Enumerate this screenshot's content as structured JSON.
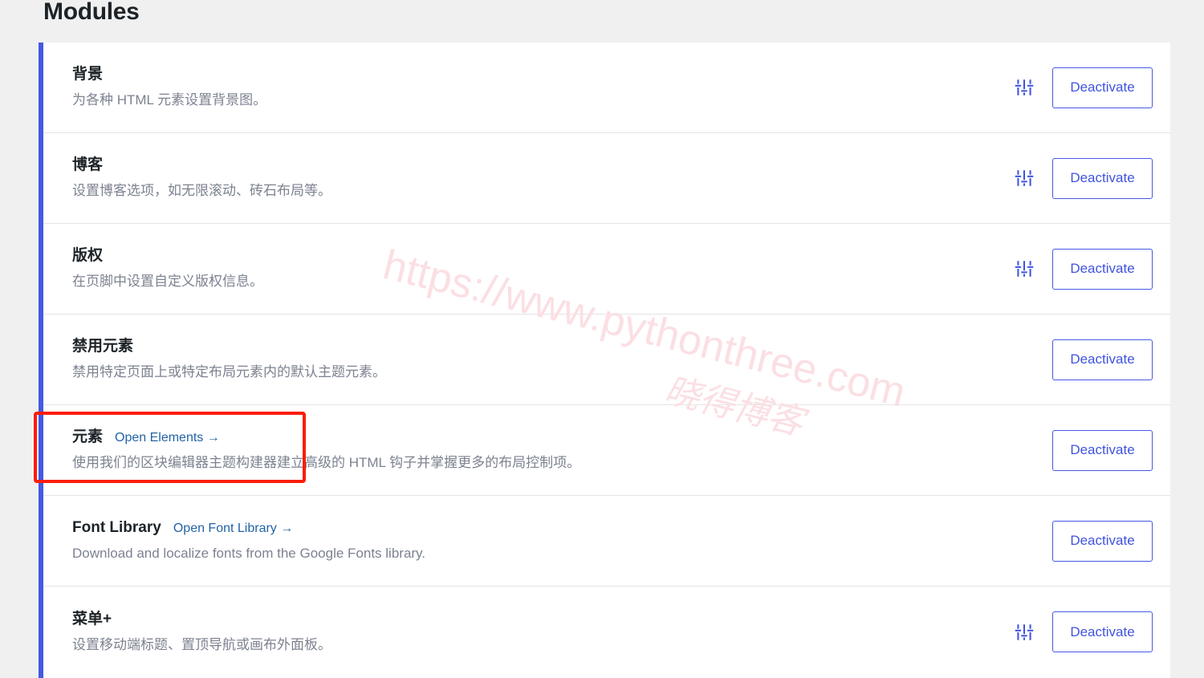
{
  "page": {
    "title": "Modules",
    "accent_color": "#4458e4",
    "link_color": "#2264a5",
    "background_color": "#f0f0f1",
    "card_background": "#ffffff",
    "annotation_color": "#fb1d08"
  },
  "watermark": {
    "url": "https://www.pythonthree.com",
    "brand": "晓得博客",
    "color": "#fbdfe3"
  },
  "modules": [
    {
      "name": "背景",
      "link": "",
      "description": "为各种 HTML 元素设置背景图。",
      "has_settings_icon": true,
      "settings_icon": "sliders-icon",
      "button_label": "Deactivate"
    },
    {
      "name": "博客",
      "link": "",
      "description": "设置博客选项，如无限滚动、砖石布局等。",
      "has_settings_icon": true,
      "settings_icon": "sliders-icon",
      "button_label": "Deactivate"
    },
    {
      "name": "版权",
      "link": "",
      "description": "在页脚中设置自定义版权信息。",
      "has_settings_icon": true,
      "settings_icon": "sliders-icon",
      "button_label": "Deactivate"
    },
    {
      "name": "禁用元素",
      "link": "",
      "description": "禁用特定页面上或特定布局元素内的默认主题元素。",
      "has_settings_icon": false,
      "settings_icon": "sliders-icon",
      "button_label": "Deactivate"
    },
    {
      "name": "元素",
      "link": "Open Elements →",
      "description": "使用我们的区块编辑器主题构建器建立高级的 HTML 钩子并掌握更多的布局控制项。",
      "has_settings_icon": false,
      "settings_icon": "sliders-icon",
      "button_label": "Deactivate"
    },
    {
      "name": "Font Library",
      "link": "Open Font Library →",
      "description": "Download and localize fonts from the Google Fonts library.",
      "has_settings_icon": false,
      "settings_icon": "sliders-icon",
      "button_label": "Deactivate"
    },
    {
      "name": "菜单+",
      "link": "",
      "description": "设置移动端标题、置顶导航或画布外面板。",
      "has_settings_icon": true,
      "settings_icon": "sliders-icon",
      "button_label": "Deactivate"
    }
  ]
}
